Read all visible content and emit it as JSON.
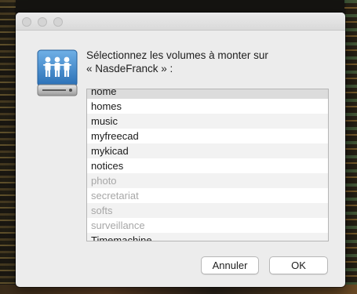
{
  "prompt": {
    "line1": "Sélectionnez les volumes à monter sur",
    "line2": "« NasdeFranck » :"
  },
  "volumes": [
    {
      "label": "home",
      "enabled": true,
      "selected": true
    },
    {
      "label": "homes",
      "enabled": true
    },
    {
      "label": "music",
      "enabled": true
    },
    {
      "label": "myfreecad",
      "enabled": true
    },
    {
      "label": "mykicad",
      "enabled": true
    },
    {
      "label": "notices",
      "enabled": true
    },
    {
      "label": "photo",
      "enabled": false
    },
    {
      "label": "secretariat",
      "enabled": false
    },
    {
      "label": "softs",
      "enabled": false
    },
    {
      "label": "surveillance",
      "enabled": false
    },
    {
      "label": "Timemachine",
      "enabled": true
    }
  ],
  "buttons": {
    "cancel": "Annuler",
    "ok": "OK"
  },
  "icons": {
    "server": "shared-server-icon"
  }
}
